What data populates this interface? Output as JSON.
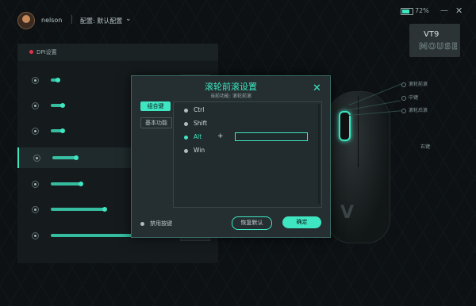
{
  "topbar": {
    "username": "nelson",
    "config_label": "配置: 默认配置",
    "battery_text": "72%",
    "minimize": "—",
    "close": "✕"
  },
  "brand": {
    "model": "VT9",
    "line": "MOUSE"
  },
  "left_panel": {
    "title": "DPI设置"
  },
  "dpi_rows": [
    {
      "level": 0.06
    },
    {
      "level": 0.1
    },
    {
      "level": 0.1
    },
    {
      "level": 0.2
    },
    {
      "level": 0.25
    },
    {
      "level": 0.45
    },
    {
      "level": 0.7
    }
  ],
  "mouse_labels": {
    "scroll_forward": "滚轮前滚",
    "middle": "中键",
    "scroll_back": "滚轮后滚",
    "left": "右键"
  },
  "modal": {
    "title": "滚轮前滚设置",
    "subtitle": "当前功能: 滚轮前滚",
    "close": "✕",
    "tabs": [
      "组合键",
      "基本功能"
    ],
    "keys": [
      {
        "label": "Ctrl",
        "selected": false
      },
      {
        "label": "Shift",
        "selected": false
      },
      {
        "label": "Alt",
        "selected": true
      },
      {
        "label": "Win",
        "selected": false
      }
    ],
    "plus": "+",
    "key_input_value": "",
    "disable_label": "禁用按键",
    "restore_label": "恢复默认",
    "ok_label": "确定"
  },
  "colors": {
    "accent": "#3fe6c2",
    "background": "#0d1113",
    "panel": "#151b1d",
    "danger": "#e0324a"
  }
}
